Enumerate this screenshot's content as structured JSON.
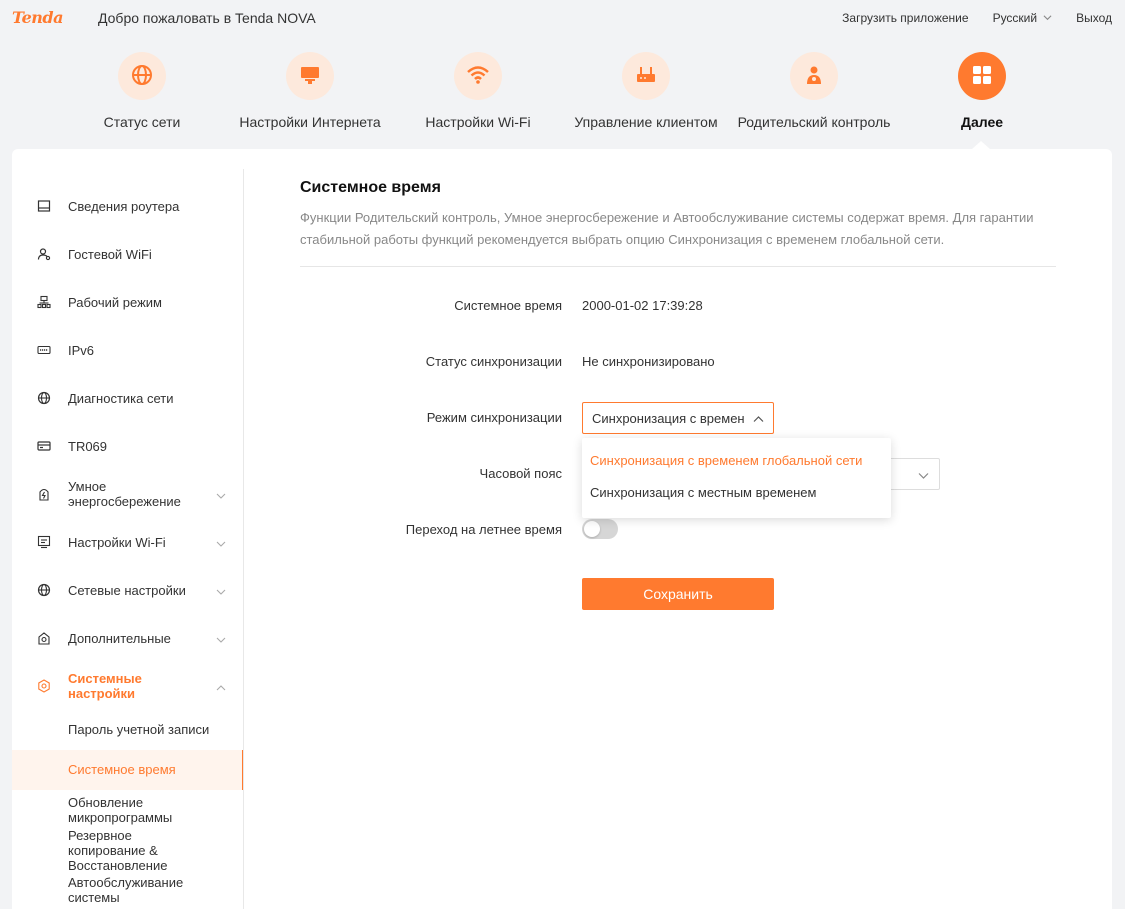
{
  "header": {
    "logo": "Tenda",
    "welcome": "Добро пожаловать в Tenda NOVA",
    "download_app": "Загрузить приложение",
    "language": "Русский",
    "logout": "Выход"
  },
  "topnav": [
    {
      "label": "Статус сети",
      "icon": "globe-icon"
    },
    {
      "label": "Настройки Интернета",
      "icon": "monitor-icon"
    },
    {
      "label": "Настройки Wi-Fi",
      "icon": "wifi-icon"
    },
    {
      "label": "Управление клиентом",
      "icon": "router-icon"
    },
    {
      "label": "Родительский контроль",
      "icon": "parent-icon"
    },
    {
      "label": "Далее",
      "icon": "grid-icon",
      "active": true
    }
  ],
  "sidebar": {
    "items": [
      {
        "label": "Сведения роутера",
        "icon": "router-info-icon"
      },
      {
        "label": "Гостевой WiFi",
        "icon": "guest-icon"
      },
      {
        "label": "Рабочий режим",
        "icon": "mode-icon"
      },
      {
        "label": "IPv6",
        "icon": "ipv6-icon"
      },
      {
        "label": "Диагностика сети",
        "icon": "globe-icon"
      },
      {
        "label": "TR069",
        "icon": "tr069-icon"
      },
      {
        "label": "Умное энергосбережение",
        "icon": "power-icon"
      },
      {
        "label": "Настройки Wi-Fi",
        "icon": "wifi-settings-icon"
      },
      {
        "label": "Сетевые настройки",
        "icon": "globe-icon"
      },
      {
        "label": "Дополнительные",
        "icon": "advanced-icon"
      },
      {
        "label": "Системные настройки",
        "icon": "settings-icon"
      }
    ],
    "subitems": [
      {
        "label": "Пароль учетной записи"
      },
      {
        "label": "Системное время"
      },
      {
        "label": "Обновление микропрограммы"
      },
      {
        "label": "Резервное копирование & Восстановление"
      },
      {
        "label": "Автообслуживание системы"
      }
    ]
  },
  "content": {
    "title": "Системное время",
    "description": "Функции Родительский контроль, Умное энергосбережение и Автообслуживание системы содержат время. Для гарантии стабильной работы функций рекомендуется выбрать опцию Синхронизация с временем глобальной сети.",
    "system_time_label": "Системное время",
    "system_time_value": "2000-01-02 17:39:28",
    "sync_status_label": "Статус синхронизации",
    "sync_status_value": "Не синхронизировано",
    "sync_mode_label": "Режим синхронизации",
    "sync_mode_value": "Синхронизация с временем глобальной сети",
    "sync_mode_options": [
      "Синхронизация с временем глобальной сети",
      "Синхронизация с местным временем"
    ],
    "timezone_label": "Часовой пояс",
    "dst_label": "Переход на летнее время",
    "dst_enabled": false,
    "save_label": "Сохранить"
  },
  "colors": {
    "accent": "#ff7a2f",
    "accent_light": "#fde9dc"
  }
}
